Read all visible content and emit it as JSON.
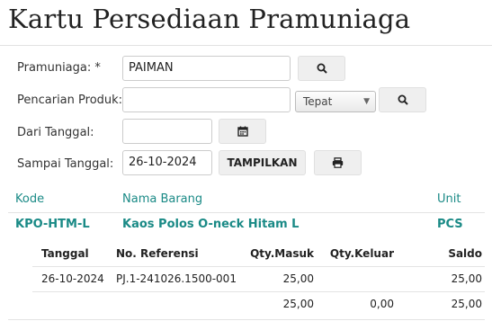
{
  "page_title": "Kartu Persediaan Pramuniaga",
  "form": {
    "salesperson_label": "Pramuniaga: *",
    "salesperson_value": "PAIMAN",
    "product_search_label": "Pencarian Produk:",
    "product_search_value": "",
    "match_mode_selected": "Tepat",
    "from_date_label": "Dari Tanggal:",
    "from_date_value": "",
    "to_date_label": "Sampai Tanggal:",
    "to_date_value": "26-10-2024",
    "show_button_label": "TAMPILKAN"
  },
  "icons": {
    "search": "search-icon",
    "calendar": "calendar-icon",
    "print": "print-icon",
    "dropdown": "chevron-down-icon"
  },
  "colors": {
    "accent": "#1a8a86"
  },
  "product_table": {
    "headers": {
      "code": "Kode",
      "name": "Nama Barang",
      "unit": "Unit"
    },
    "row": {
      "code": "KPO-HTM-L",
      "name": "Kaos Polos O-neck Hitam L",
      "unit": "PCS"
    }
  },
  "movement_table": {
    "headers": {
      "date": "Tanggal",
      "reference": "No. Referensi",
      "qty_in": "Qty.Masuk",
      "qty_out": "Qty.Keluar",
      "balance": "Saldo"
    },
    "rows": [
      {
        "date": "26-10-2024",
        "reference": "PJ.1-241026.1500-001",
        "qty_in": "25,00",
        "qty_out": "",
        "balance": "25,00"
      }
    ],
    "totals": {
      "qty_in": "25,00",
      "qty_out": "0,00",
      "balance": "25,00"
    }
  }
}
